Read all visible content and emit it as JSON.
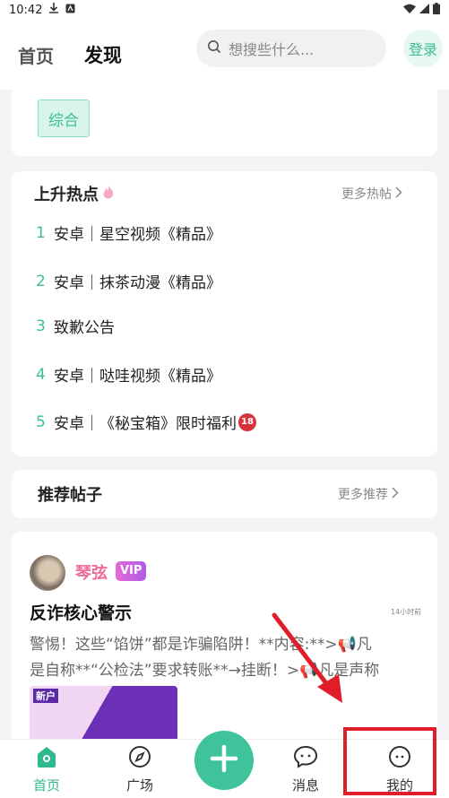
{
  "status_bar": {
    "time": "10:42"
  },
  "header": {
    "tabs": [
      {
        "label": "首页",
        "active": false
      },
      {
        "label": "发现",
        "active": true
      }
    ],
    "search_placeholder": "想搜些什么...",
    "login_label": "登录"
  },
  "category_tag": "综合",
  "hot": {
    "title": "上升热点",
    "more_label": "更多热帖",
    "items": [
      {
        "rank": "1",
        "text": "安卓｜星空视频《精品》"
      },
      {
        "rank": "2",
        "text": "安卓｜抹茶动漫《精品》"
      },
      {
        "rank": "3",
        "text": "致歉公告"
      },
      {
        "rank": "4",
        "text": "安卓｜哒哇视频《精品》"
      },
      {
        "rank": "5",
        "text": "安卓｜《秘宝箱》限时福利",
        "badge": "18"
      }
    ]
  },
  "recommend": {
    "title": "推荐帖子",
    "more_label": "更多推荐"
  },
  "post": {
    "username": "琴弦",
    "vip_label": "VIP",
    "title": "反诈核心警示",
    "time": "14小时前",
    "body_line1": "警惕！这些“馅饼”都是诈骗陷阱！**内容:**>📢凡",
    "body_line2": "是自称**“公检法”要求转账**→挂断！>📢凡是声称",
    "thumb_text": "新户"
  },
  "bottom_nav": [
    {
      "label": "首页",
      "icon": "home-icon",
      "active": true
    },
    {
      "label": "广场",
      "icon": "compass-icon",
      "active": false
    },
    {
      "label": "消息",
      "icon": "message-icon",
      "active": false
    },
    {
      "label": "我的",
      "icon": "profile-icon",
      "active": false
    }
  ],
  "colors": {
    "accent": "#3ec39a",
    "highlight": "#e11d2a"
  }
}
